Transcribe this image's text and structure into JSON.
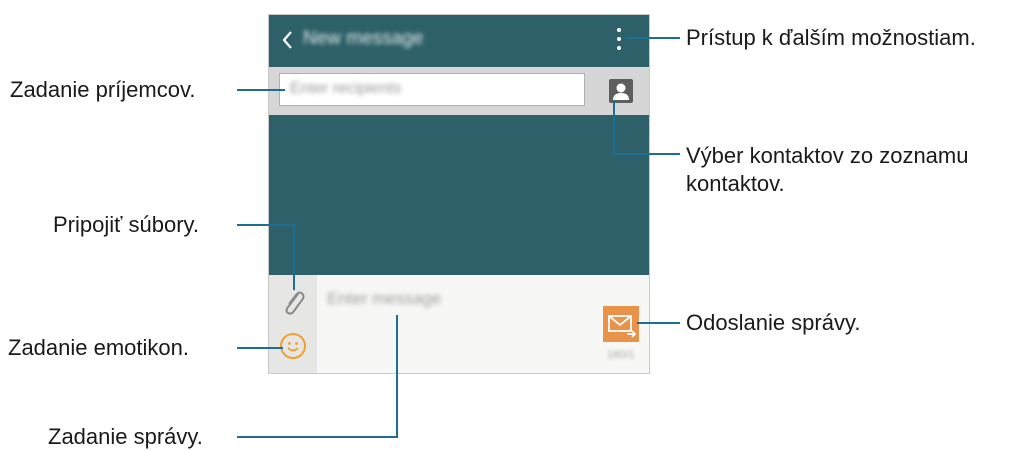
{
  "screen": {
    "title": "New message",
    "recipients_placeholder": "Enter recipients",
    "message_placeholder": "Enter message",
    "send_counter": "160/1"
  },
  "callouts": {
    "more_options": "Prístup k ďalším možnostiam.",
    "recipients": "Zadanie príjemcov.",
    "contacts": "Výber kontaktov zo zoznamu kontaktov.",
    "attach": "Pripojiť súbory.",
    "emoticons": "Zadanie emotikon.",
    "send": "Odoslanie správy.",
    "message": "Zadanie správy."
  },
  "icons": {
    "back": "chevron-left-icon",
    "more": "more-vertical-icon",
    "contact": "contact-icon",
    "attach": "paperclip-icon",
    "emoticon": "smiley-icon",
    "send": "envelope-send-icon"
  },
  "colors": {
    "appbar": "#2d6068",
    "callout_line": "#1c6f94",
    "send_button": "#e8924a",
    "emoticon": "#f0a030"
  }
}
